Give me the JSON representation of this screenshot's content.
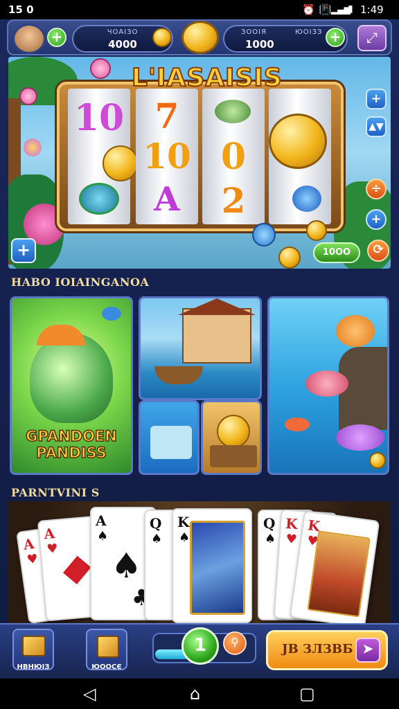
{
  "status_bar": {
    "time_left": "15 0",
    "time_right": "1:49",
    "icons": [
      "alarm-icon",
      "vibrate-icon",
      "signal-icon",
      "wifi-icon",
      "battery-icon"
    ]
  },
  "hud": {
    "player_name_label": "ЧОАІЗО",
    "player_coins": "4000",
    "level_label": "ЗООІЯ",
    "level_value": "1000",
    "bonus_label": "ЮОІЗЗ",
    "settings_icon": "expand-icon"
  },
  "slot": {
    "title": "L'IASAISIS",
    "reels": [
      [
        "10",
        "",
        ""
      ],
      [
        "7",
        "10",
        "A"
      ],
      [
        "",
        "0",
        "2"
      ],
      [
        "",
        "",
        ""
      ]
    ],
    "spin_label": "10ОО"
  },
  "sections": {
    "featured_title": "HABO IOIAINGANOA",
    "cards_title": "PARNTVINI S"
  },
  "tiles": {
    "fish_caption_line1": "GPANDOEN",
    "fish_caption_line2": "PANDISS"
  },
  "cards": [
    {
      "rank": "A",
      "suit": "♥",
      "color": "red"
    },
    {
      "rank": "A",
      "suit": "♥",
      "color": "red"
    },
    {
      "rank": "A",
      "suit": "♠",
      "color": "black"
    },
    {
      "rank": "Q",
      "suit": "♠",
      "color": "black"
    },
    {
      "rank": "K",
      "suit": "♠",
      "color": "black"
    },
    {
      "rank": "Q",
      "suit": "♠",
      "color": "black"
    },
    {
      "rank": "K",
      "suit": "♥",
      "color": "red"
    },
    {
      "rank": "K",
      "suit": "♥",
      "color": "red"
    }
  ],
  "bottom_bar": {
    "nav1_label": "НВНЮІЗ",
    "nav2_label": "ЮООСЄ",
    "level_number": "1",
    "play_label": "JB ЗЛЗВБ",
    "progress": 0.45
  },
  "colors": {
    "accent_gold": "#ffd23a",
    "accent_blue": "#5c78c8",
    "play_orange": "#f08a12"
  }
}
